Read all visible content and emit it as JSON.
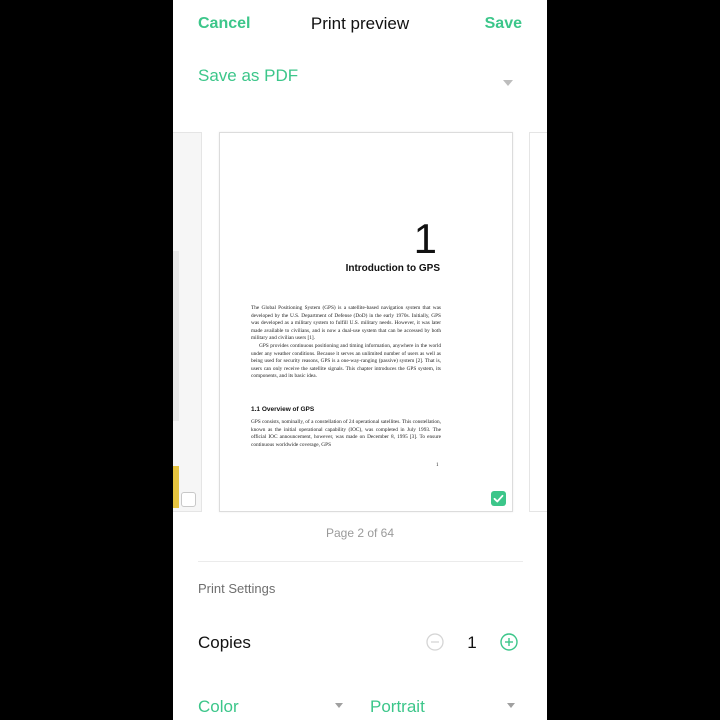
{
  "header": {
    "cancel_label": "Cancel",
    "title": "Print preview",
    "save_label": "Save"
  },
  "destination": {
    "selected": "Save as PDF"
  },
  "preview": {
    "chapter_number": "1",
    "chapter_title": "Introduction to GPS",
    "paragraphs": [
      "The Global Positioning System (GPS) is a satellite-based navigation system that was developed by the U.S. Department of Defense (DoD) in the early 1970s. Initially, GPS was developed as a military system to fulfill U.S. military needs. However, it was later made available to civilians, and is now a dual-use system that can be accessed by both military and civilian users [1].",
      "GPS provides continuous positioning and timing information, anywhere in the world under any weather conditions. Because it serves an unlimited number of users as well as being used for security reasons, GPS is a one-way-ranging (passive) system [2]. That is, users can only receive the satellite signals. This chapter introduces the GPS system, its components, and its basic idea."
    ],
    "section_title": "1.1   Overview of GPS",
    "section_paragraph": "GPS consists, nominally, of a constellation of 24 operational satellites. This constellation, known as the initial operational capability (IOC), was completed in July 1993. The official IOC announcement, however, was made on December 8, 1995 [3]. To ensure continuous worldwide coverage, GPS",
    "page_number": "1",
    "page_indicator": "Page 2 of 64"
  },
  "settings": {
    "section_label": "Print Settings",
    "copies_label": "Copies",
    "copies_value": "1",
    "color_value": "Color",
    "orientation_value": "Portrait"
  },
  "colors": {
    "accent": "#3cc68a",
    "background_outside": "#000000"
  }
}
